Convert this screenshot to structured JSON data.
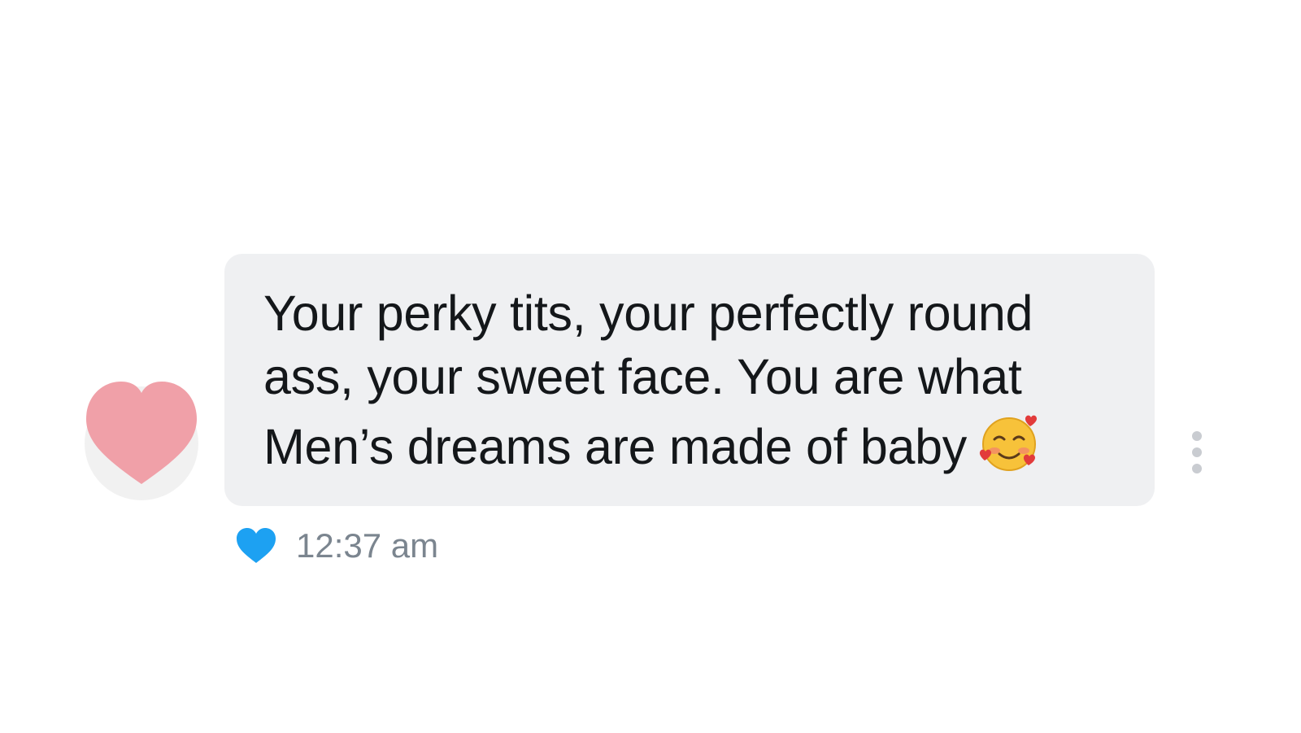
{
  "message": {
    "text": "Your perky tits, your perfectly round ass, your sweet face. You are what Men’s dreams are made of baby",
    "emoji": "smiling-face-with-hearts"
  },
  "meta": {
    "timestamp": "12:37 am",
    "like_state": "liked"
  },
  "avatar": {
    "icon": "pink-heart"
  },
  "colors": {
    "bubble": "#eff0f2",
    "avatar_heart": "#f0a0a8",
    "like_heart": "#1da1f2",
    "text": "#14171a",
    "timestamp": "#7b858f"
  }
}
